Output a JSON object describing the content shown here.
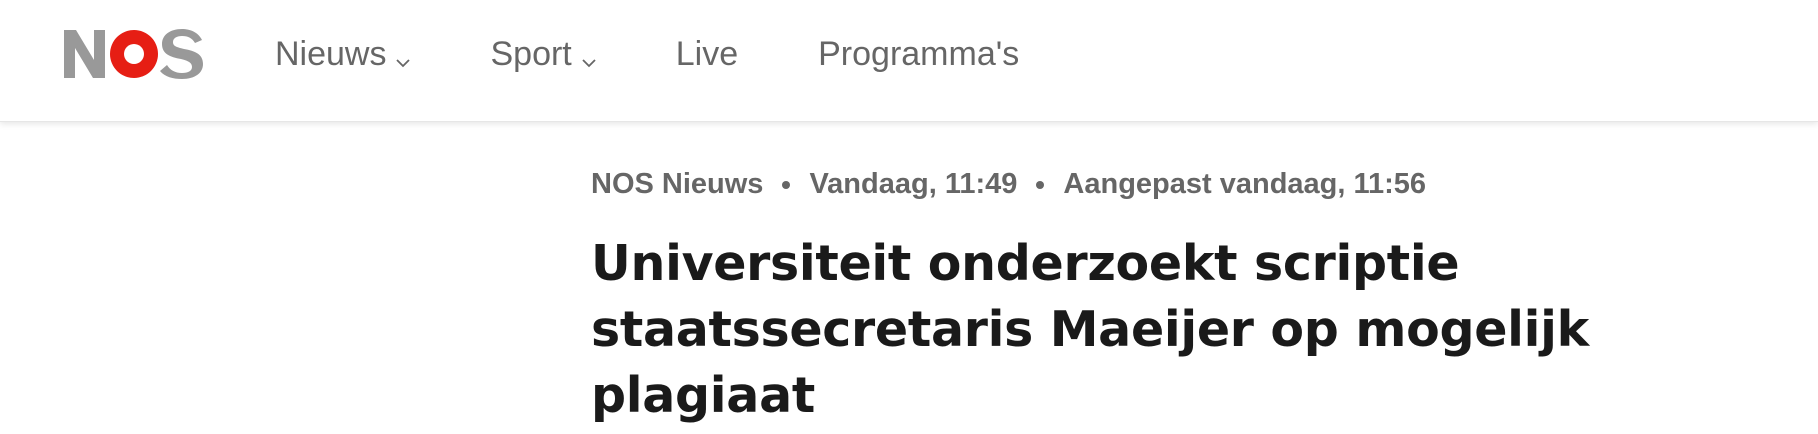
{
  "logo": {
    "text": "NOS",
    "colors": {
      "letters": "#999999",
      "o_ring": "#e61e14",
      "o_center": "#ffffff"
    }
  },
  "nav": {
    "items": [
      {
        "label": "Nieuws",
        "has_dropdown": true
      },
      {
        "label": "Sport",
        "has_dropdown": true
      },
      {
        "label": "Live",
        "has_dropdown": false
      },
      {
        "label": "Programma's",
        "has_dropdown": false
      }
    ]
  },
  "article": {
    "meta": {
      "source": "NOS Nieuws",
      "published": "Vandaag, 11:49",
      "updated": "Aangepast vandaag, 11:56"
    },
    "headline": "Universiteit onderzoekt scriptie staatssecretaris Maeijer op mogelijk plagiaat"
  },
  "colors": {
    "nav_text": "#666666",
    "headline_text": "#1a1a1a",
    "brand_red": "#e61e14"
  }
}
